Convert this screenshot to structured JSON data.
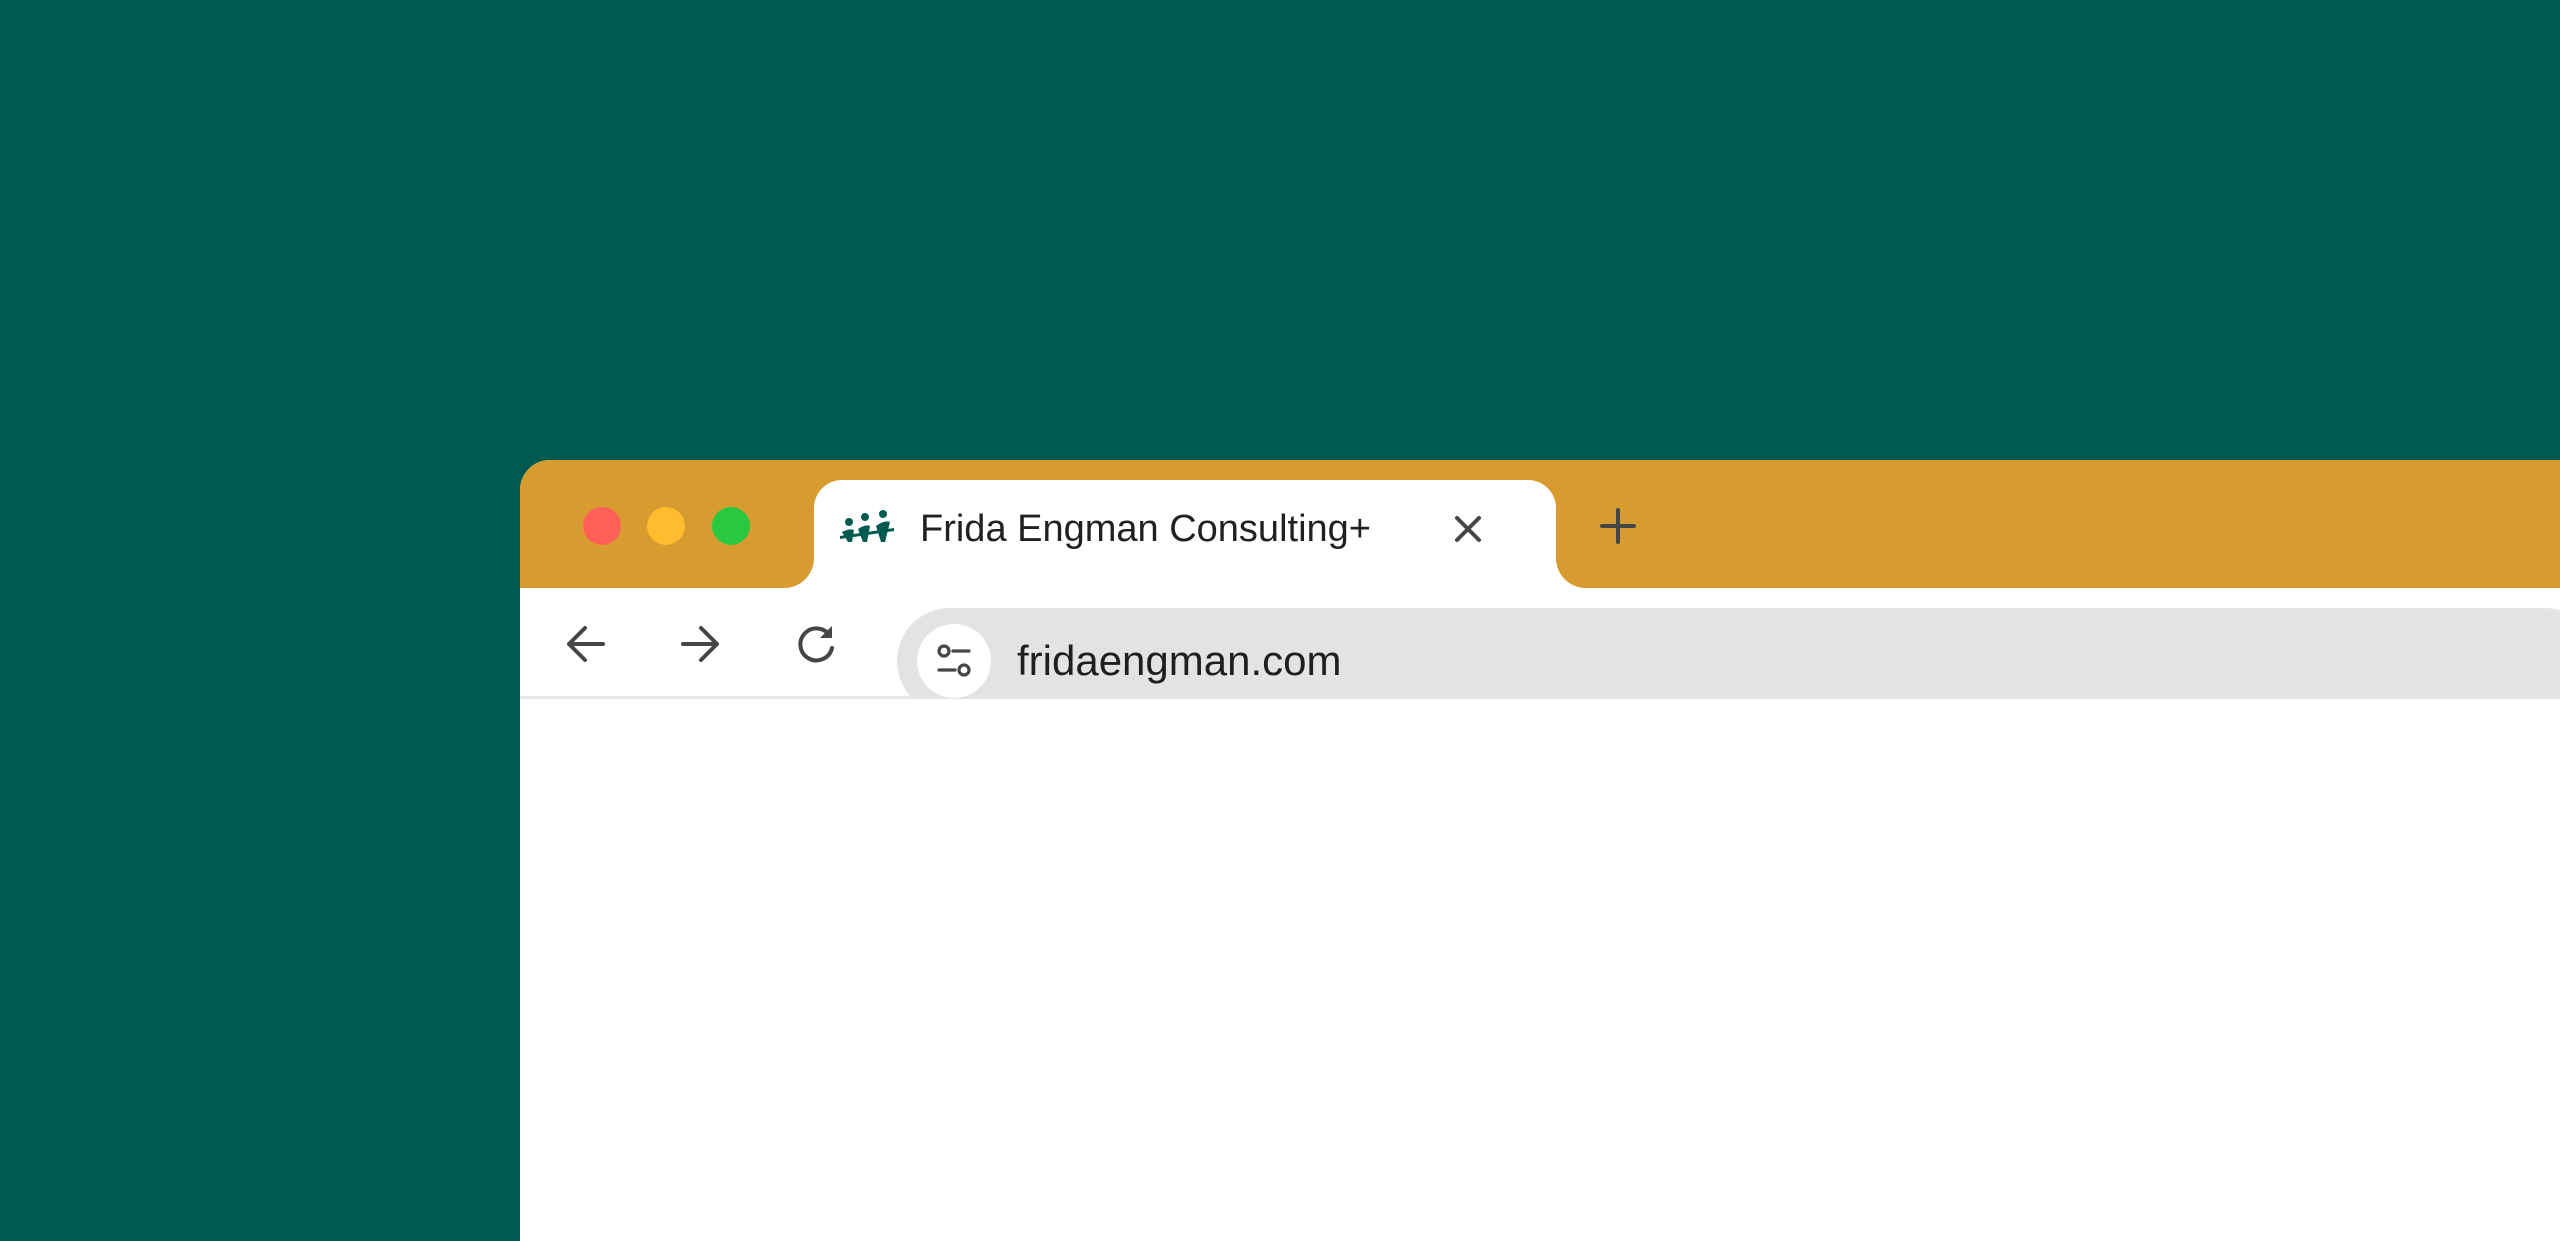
{
  "colors": {
    "background": "#015a4f",
    "tabstrip": "#d89b2f",
    "close_dot": "#ff5f57",
    "minimize_dot": "#febc2e",
    "maximize_dot": "#28c840",
    "omnibox": "#e3e3e1",
    "favicon": "#015a4f"
  },
  "window_controls": {
    "close_icon": "red-circle",
    "minimize_icon": "yellow-circle",
    "maximize_icon": "green-circle"
  },
  "tab": {
    "favicon": "people-logo-icon",
    "title": "Frida Engman Consulting+",
    "close_icon": "close-icon"
  },
  "new_tab_icon": "plus-icon",
  "toolbar": {
    "back_icon": "arrow-left-icon",
    "forward_icon": "arrow-right-icon",
    "reload_icon": "reload-icon"
  },
  "address_bar": {
    "site_info_icon": "tune-icon",
    "url": "fridaengman.com"
  }
}
